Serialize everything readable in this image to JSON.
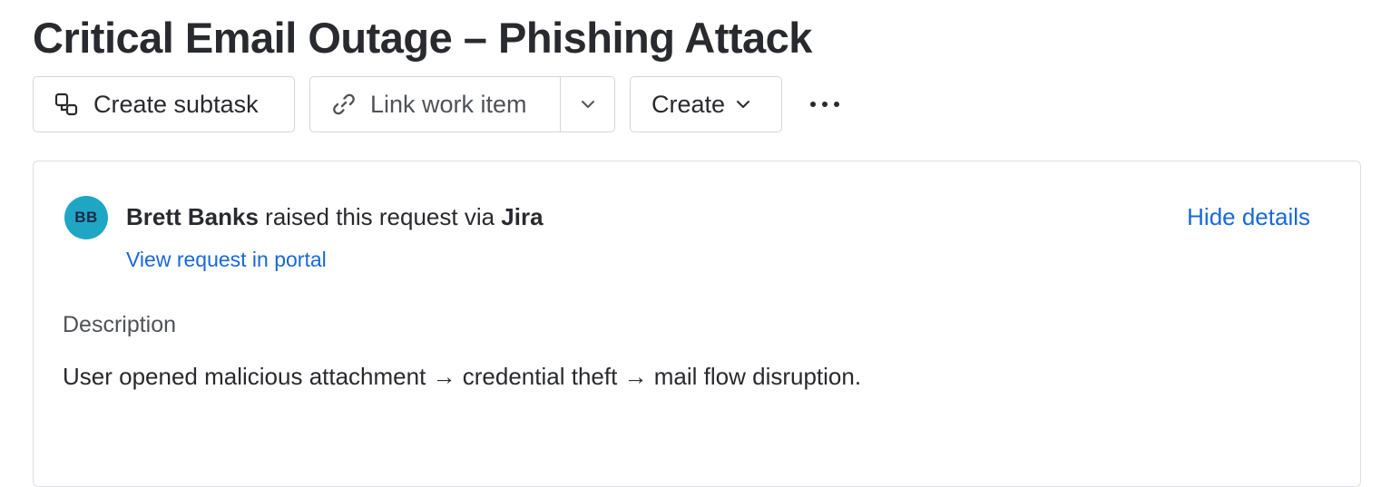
{
  "page": {
    "title": "Critical Email Outage – Phishing Attack"
  },
  "toolbar": {
    "create_subtask_label": "Create subtask",
    "create_subtask_icon": "subtask-icon",
    "link_work_item_label": "Link work item",
    "link_work_item_icon": "link-icon",
    "link_dropdown_icon": "chevron-down-icon",
    "create_label": "Create",
    "create_icon": "chevron-down-icon",
    "more_icon": "more-horizontal-icon"
  },
  "request": {
    "avatar_initials": "BB",
    "avatar_color": "#1fa6c4",
    "reporter_name": "Brett Banks",
    "raised_text": " raised this request via ",
    "channel": "Jira",
    "portal_link": "View request in portal",
    "hide_details": "Hide details"
  },
  "description": {
    "heading": "Description",
    "body": "User opened malicious attachment → credential theft → mail flow disruption."
  },
  "colors": {
    "link": "#1868db",
    "text": "#292a2e",
    "border": "#d4d6da"
  }
}
